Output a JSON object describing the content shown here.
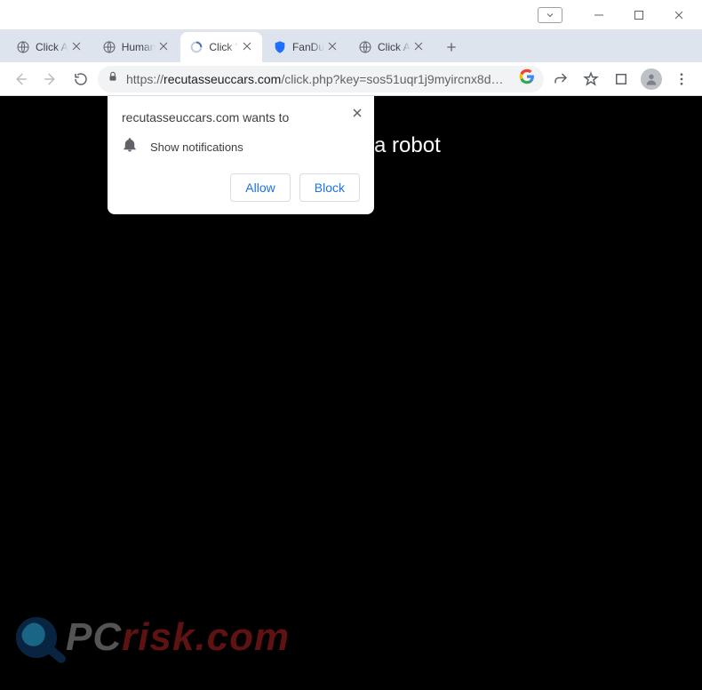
{
  "window": {
    "controls": {
      "minimize": "minimize",
      "maximize": "maximize",
      "close": "close"
    }
  },
  "tabs": [
    {
      "title": "Click A",
      "favicon": "globe"
    },
    {
      "title": "Human",
      "favicon": "globe"
    },
    {
      "title": "Click \"",
      "favicon": "spinner",
      "active": true
    },
    {
      "title": "FanDu",
      "favicon": "shield"
    },
    {
      "title": "Click A",
      "favicon": "globe"
    }
  ],
  "toolbar": {
    "url_display_host": "recutasseuccars.com",
    "url_display_path": "/click.php?key=sos51uqr1j9myircnx8d…",
    "url_prefix": "https://"
  },
  "notification": {
    "title": "recutasseuccars.com wants to",
    "permission_label": "Show notifications",
    "allow_label": "Allow",
    "block_label": "Block"
  },
  "page": {
    "robot_text": "you are not a robot"
  },
  "watermark": {
    "brand_prefix": "PC",
    "brand_suffix": "risk.com"
  }
}
